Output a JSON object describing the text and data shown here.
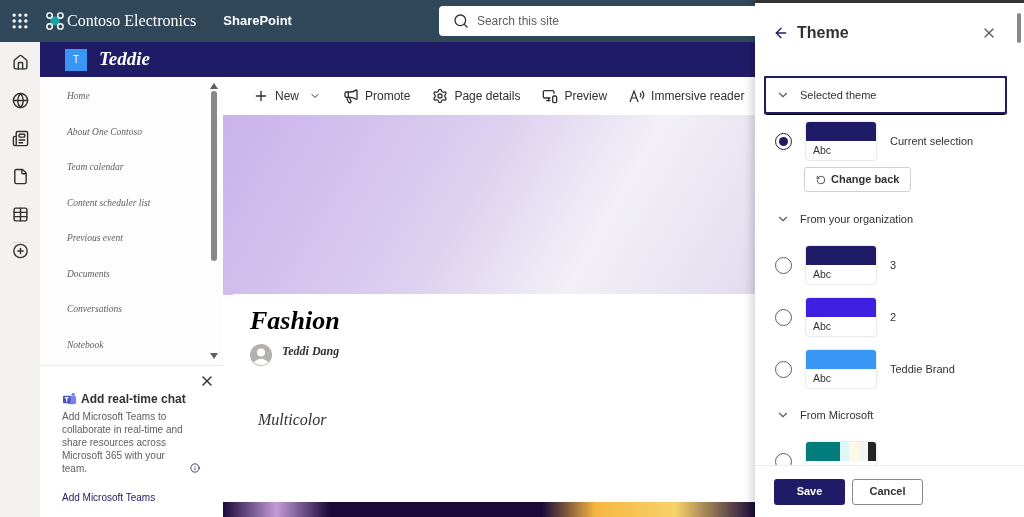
{
  "top_bar": {
    "org": "Contoso Electronics",
    "app": "SharePoint",
    "search": {
      "placeholder": "Search this site"
    }
  },
  "site": {
    "logo_letter": "T",
    "name": "Teddie"
  },
  "nav": {
    "items": [
      {
        "label": "Home"
      },
      {
        "label": "About One Contoso"
      },
      {
        "label": "Team calendar"
      },
      {
        "label": "Content scheduler list"
      },
      {
        "label": "Previous event"
      },
      {
        "label": "Documents"
      },
      {
        "label": "Conversations"
      },
      {
        "label": "Notebook"
      }
    ]
  },
  "teams_card": {
    "title": "Add real-time chat",
    "text": "Add Microsoft Teams to collaborate in real-time and share resources across Microsoft 365 with your team.",
    "link": "Add Microsoft Teams"
  },
  "toolbar": {
    "items": [
      {
        "kind": "new",
        "label": "New"
      },
      {
        "kind": "promote",
        "label": "Promote"
      },
      {
        "kind": "details",
        "label": "Page details"
      },
      {
        "kind": "preview",
        "label": "Preview"
      },
      {
        "kind": "reader",
        "label": "Immersive reader"
      }
    ]
  },
  "page": {
    "title": "Fashion",
    "author": "Teddi Dang",
    "text": "Multicolor"
  },
  "theme_panel": {
    "title": "Theme",
    "sections": [
      {
        "title": "Selected theme",
        "focused": true,
        "expanded": true,
        "action": "Change back",
        "themes": [
          {
            "name": "Current selection",
            "sample": "Abc",
            "color": "#201b66",
            "selected": true
          }
        ]
      },
      {
        "title": "From your organization",
        "focused": false,
        "expanded": true,
        "themes": [
          {
            "name": "3",
            "sample": "Abc",
            "color": "#201b66",
            "selected": false
          },
          {
            "name": "2",
            "sample": "Abc",
            "color": "#3f20e0",
            "selected": false
          },
          {
            "name": "Teddie Brand",
            "sample": "Abc",
            "color": "#3a96f5",
            "selected": false
          }
        ]
      },
      {
        "title": "From Microsoft",
        "focused": false,
        "expanded": true,
        "themes": [
          {
            "kind": "palette",
            "color": "#037c7c",
            "selected": false
          }
        ]
      }
    ],
    "buttons": [
      {
        "kind": "primary",
        "label": "Save"
      },
      {
        "kind": "secondary",
        "label": "Cancel"
      }
    ]
  }
}
